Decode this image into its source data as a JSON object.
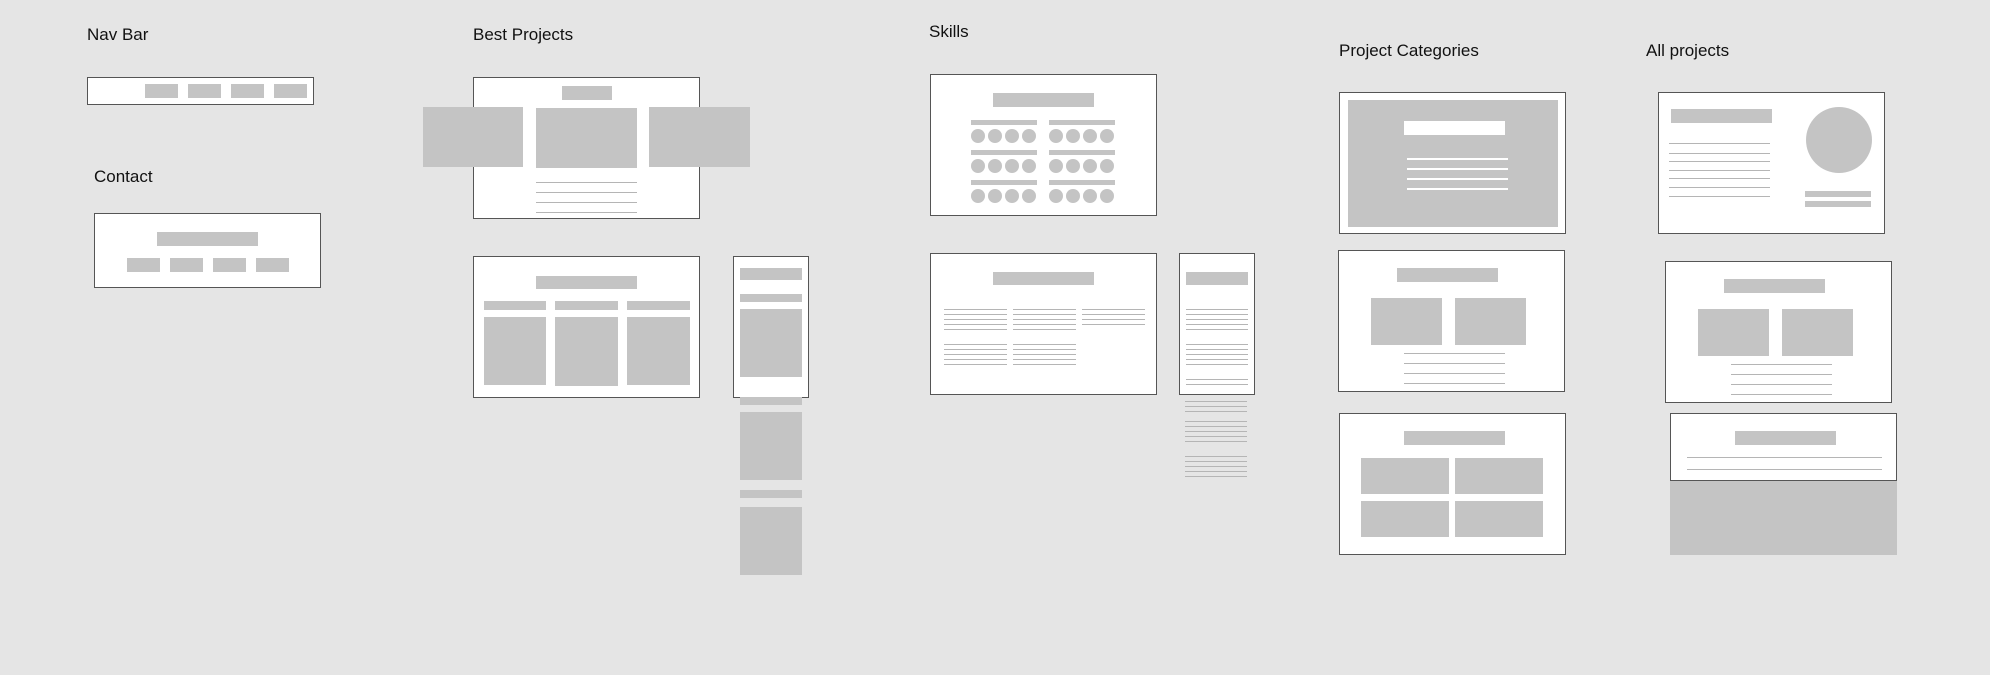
{
  "sections": {
    "nav_bar": "Nav Bar",
    "contact": "Contact",
    "best_projects": "Best Projects",
    "skills": "Skills",
    "project_categories": "Project Categories",
    "all_projects": "All projects"
  },
  "colors": {
    "canvas": "#e5e5e5",
    "frame": "#ffffff",
    "frame_border": "#555555",
    "placeholder": "#c4c4c4",
    "text_line": "#b5b5b5"
  }
}
